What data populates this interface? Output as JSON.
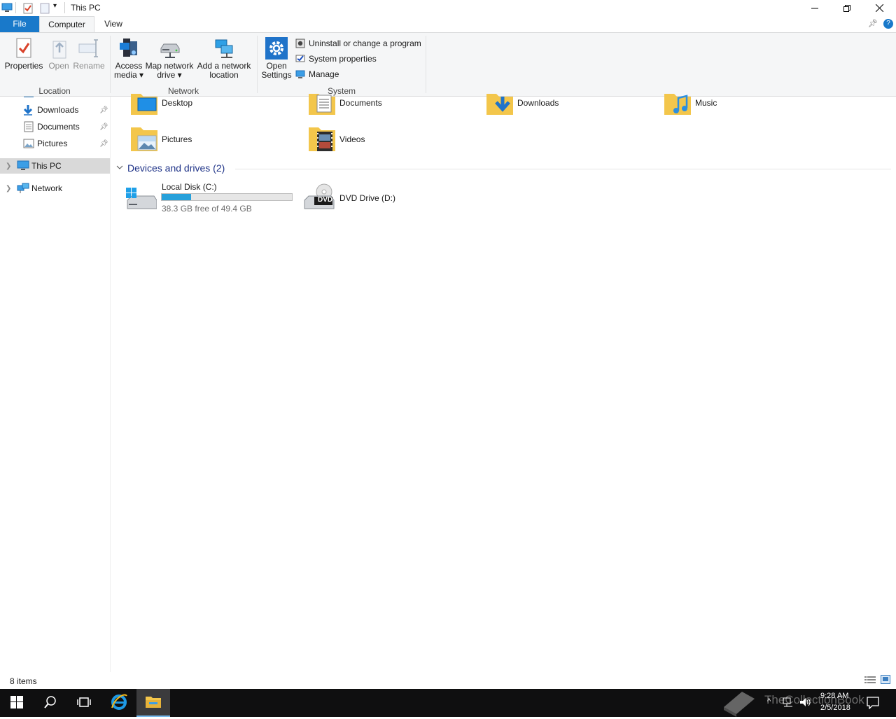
{
  "window": {
    "title": "This PC",
    "controls": {
      "minimize": "—",
      "restore": "❐",
      "close": "✕"
    }
  },
  "ribbon_tabs": [
    {
      "label": "File"
    },
    {
      "label": "Computer"
    },
    {
      "label": "View"
    }
  ],
  "ribbon": {
    "location": {
      "group_label": "Location",
      "properties": "Properties",
      "open": "Open",
      "rename": "Rename"
    },
    "network": {
      "group_label": "Network",
      "access_media_line1": "Access",
      "access_media_line2": "media ▾",
      "map_drive_line1": "Map network",
      "map_drive_line2": "drive ▾",
      "add_location_line1": "Add a network",
      "add_location_line2": "location"
    },
    "system": {
      "group_label": "System",
      "open_settings_line1": "Open",
      "open_settings_line2": "Settings",
      "uninstall": "Uninstall or change a program",
      "system_properties": "System properties",
      "manage": "Manage"
    }
  },
  "nav": {
    "quick_access": [
      {
        "label": "Downloads",
        "pinned": true,
        "icon": "download-arrow-icon"
      },
      {
        "label": "Documents",
        "pinned": true,
        "icon": "document-icon"
      },
      {
        "label": "Pictures",
        "pinned": true,
        "icon": "picture-icon"
      }
    ],
    "this_pc": "This PC",
    "network": "Network"
  },
  "folders": [
    {
      "label": "Desktop",
      "icon": "desktop-folder-icon"
    },
    {
      "label": "Documents",
      "icon": "documents-folder-icon"
    },
    {
      "label": "Downloads",
      "icon": "downloads-folder-icon"
    },
    {
      "label": "Music",
      "icon": "music-folder-icon"
    },
    {
      "label": "Pictures",
      "icon": "pictures-folder-icon"
    },
    {
      "label": "Videos",
      "icon": "videos-folder-icon"
    }
  ],
  "devices_section": {
    "header": "Devices and drives (2)"
  },
  "drives": {
    "c": {
      "label": "Local Disk (C:)",
      "free_text": "38.3 GB free of 49.4 GB",
      "used_fraction": 0.225
    },
    "d": {
      "label": "DVD Drive (D:)",
      "badge": "DVD"
    }
  },
  "status_bar": {
    "item_count": "8 items"
  },
  "taskbar": {
    "time": "9:28 AM",
    "date": "2/5/2018",
    "watermark": "TheCollectionBook"
  },
  "colors": {
    "accent": "#1979ca",
    "folder_yellow": "#f3c64b",
    "section_header": "#1e3287",
    "drive_bar": "#26a0da"
  }
}
